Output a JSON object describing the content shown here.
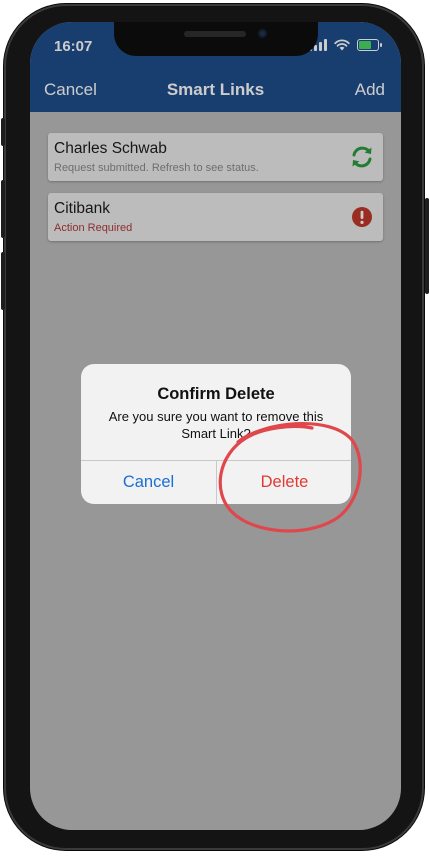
{
  "status_bar": {
    "time": "16:07"
  },
  "nav": {
    "cancel_label": "Cancel",
    "title": "Smart Links",
    "add_label": "Add",
    "color": "#1f4e8b"
  },
  "links": [
    {
      "name": "Charles Schwab",
      "status": "Request submitted. Refresh to see status.",
      "icon": "refresh-icon",
      "icon_color": "#2e9a3f"
    },
    {
      "name": "Citibank",
      "status": "Action Required",
      "icon": "alert-icon",
      "icon_color": "#c0392b"
    }
  ],
  "dialog": {
    "title": "Confirm Delete",
    "message": "Are you sure you want to remove this Smart Link?",
    "cancel_label": "Cancel",
    "delete_label": "Delete",
    "cancel_color": "#1a6fd6",
    "delete_color": "#e03a34"
  },
  "annotation": {
    "shape": "hand-drawn circle around Delete button",
    "color": "#e0474c"
  }
}
